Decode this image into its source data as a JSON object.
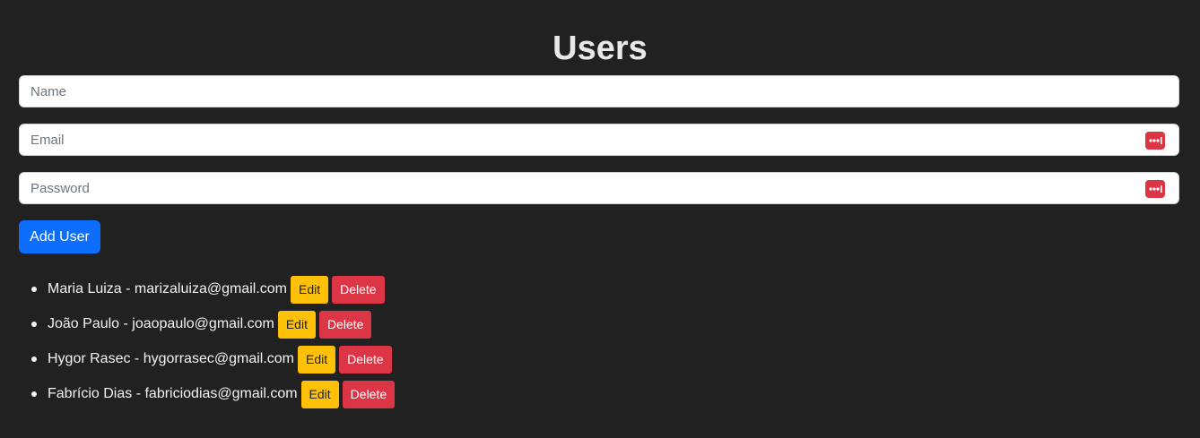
{
  "page_title": "Users",
  "form": {
    "name": {
      "placeholder": "Name",
      "value": ""
    },
    "email": {
      "placeholder": "Email",
      "value": ""
    },
    "password": {
      "placeholder": "Password",
      "value": ""
    },
    "add_button_label": "Add User",
    "password_manager_icon": "password-manager-icon"
  },
  "users": [
    {
      "text": "Maria Luiza - marizaluiza@gmail.com",
      "edit_label": "Edit",
      "delete_label": "Delete"
    },
    {
      "text": "João Paulo - joaopaulo@gmail.com",
      "edit_label": "Edit",
      "delete_label": "Delete"
    },
    {
      "text": "Hygor Rasec - hygorrasec@gmail.com",
      "edit_label": "Edit",
      "delete_label": "Delete"
    },
    {
      "text": "Fabrício Dias - fabriciodias@gmail.com",
      "edit_label": "Edit",
      "delete_label": "Delete"
    }
  ],
  "colors": {
    "background": "#212121",
    "primary": "#0d6efd",
    "warning": "#ffc107",
    "danger": "#dc3545"
  }
}
